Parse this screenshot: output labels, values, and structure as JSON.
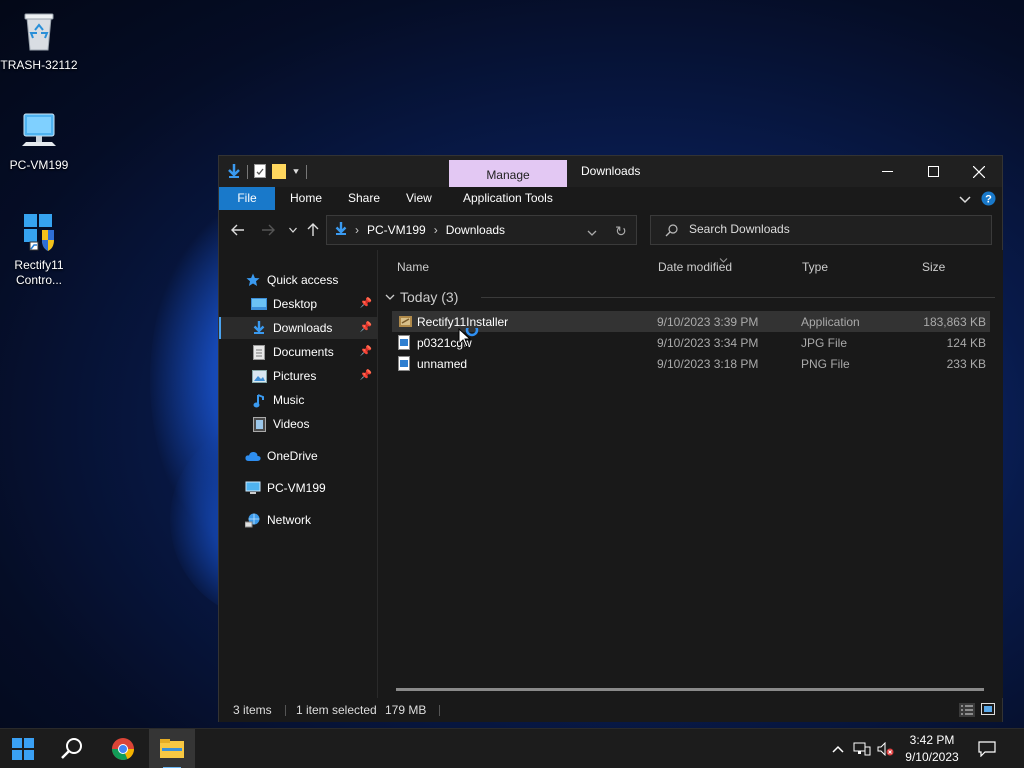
{
  "desktop": {
    "icons": [
      {
        "label": "TRASH-32112"
      },
      {
        "label": "PC-VM199"
      },
      {
        "label": "Rectify11 Contro..."
      }
    ]
  },
  "window": {
    "manage_tab": "Manage",
    "title": "Downloads",
    "ribbon_tabs": [
      "File",
      "Home",
      "Share",
      "View",
      "Application Tools"
    ],
    "address": {
      "crumbs": [
        "PC-VM199",
        "Downloads"
      ]
    },
    "search": {
      "placeholder": "Search Downloads"
    },
    "nav": {
      "quick_access": "Quick access",
      "items": [
        {
          "label": "Desktop",
          "pinned": true
        },
        {
          "label": "Downloads",
          "pinned": true,
          "selected": true
        },
        {
          "label": "Documents",
          "pinned": true
        },
        {
          "label": "Pictures",
          "pinned": true
        },
        {
          "label": "Music",
          "pinned": false
        },
        {
          "label": "Videos",
          "pinned": false
        }
      ],
      "onedrive": "OneDrive",
      "this_pc": "PC-VM199",
      "network": "Network"
    },
    "columns": {
      "name": "Name",
      "date": "Date modified",
      "type": "Type",
      "size": "Size"
    },
    "group": "Today (3)",
    "files": [
      {
        "name": "Rectify11Installer",
        "date": "9/10/2023 3:39 PM",
        "type": "Application",
        "size": "183,863 KB",
        "selected": true
      },
      {
        "name": "p0321cgw",
        "date": "9/10/2023 3:34 PM",
        "type": "JPG File",
        "size": "124 KB",
        "selected": false
      },
      {
        "name": "unnamed",
        "date": "9/10/2023 3:18 PM",
        "type": "PNG File",
        "size": "233 KB",
        "selected": false
      }
    ],
    "status": {
      "items": "3 items",
      "selected": "1 item selected",
      "size": "179 MB"
    }
  },
  "taskbar": {
    "time": "3:42 PM",
    "date": "9/10/2023"
  },
  "colors": {
    "accent": "#1979ca",
    "manage": "#e3c8f3"
  }
}
